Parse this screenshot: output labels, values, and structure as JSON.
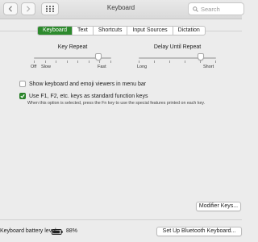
{
  "window": {
    "title": "Keyboard",
    "search_placeholder": "Search"
  },
  "tabs": [
    {
      "label": "Keyboard",
      "active": true
    },
    {
      "label": "Text",
      "active": false
    },
    {
      "label": "Shortcuts",
      "active": false
    },
    {
      "label": "Input Sources",
      "active": false
    },
    {
      "label": "Dictation",
      "active": false
    }
  ],
  "key_repeat": {
    "title": "Key Repeat",
    "min_labels": [
      "Off",
      "Slow"
    ],
    "max_label": "Fast",
    "value": 0.83
  },
  "delay_until_repeat": {
    "title": "Delay Until Repeat",
    "min_label": "Long",
    "max_label": "Short",
    "value": 0.8
  },
  "options": {
    "show_viewers_label": "Show keyboard and emoji viewers in menu bar",
    "show_viewers_checked": false,
    "function_keys_label": "Use F1, F2, etc. keys as standard function keys",
    "function_keys_checked": true,
    "function_keys_hint": "When this option is selected, press the Fn key to use the special features printed on each key."
  },
  "buttons": {
    "modifier_keys": "Modifier Keys...",
    "bluetooth_setup": "Set Up Bluetooth Keyboard..."
  },
  "footer": {
    "battery_label": "Keyboard battery level:",
    "battery_percent": "88%",
    "battery_level": 0.88
  },
  "colors": {
    "accent": "#2d8a2d"
  }
}
